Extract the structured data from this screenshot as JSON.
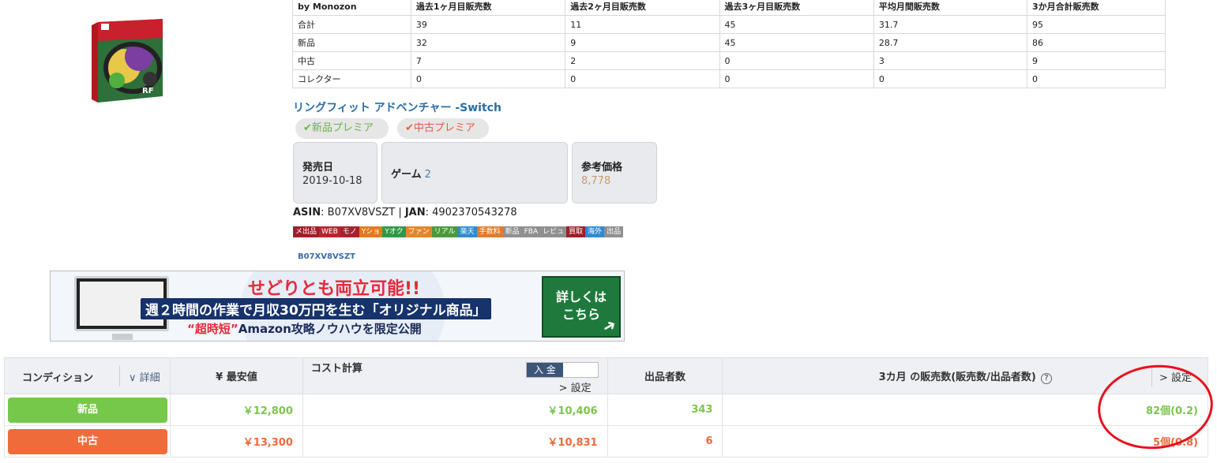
{
  "sales_table": {
    "headers": [
      "by Monozon",
      "過去1ヶ月目販売数",
      "過去2ヶ月目販売数",
      "過去3ヶ月目販売数",
      "平均月間販売数",
      "3か月合計販売数"
    ],
    "rows": [
      [
        "合計",
        "39",
        "11",
        "45",
        "31.7",
        "95"
      ],
      [
        "新品",
        "32",
        "9",
        "45",
        "28.7",
        "86"
      ],
      [
        "中古",
        "7",
        "2",
        "0",
        "3",
        "9"
      ],
      [
        "コレクター",
        "0",
        "0",
        "0",
        "0",
        "0"
      ]
    ]
  },
  "product": {
    "title": "リングフィット アドベンチャー -Switch",
    "badge_new": "✔新品プレミア",
    "badge_used": "✔中古プレミア",
    "release_label": "発売日",
    "release_value": "2019-10-18",
    "genre_label": "ゲーム",
    "genre_rank": "2",
    "price_label": "参考価格",
    "price_value": "8,778",
    "asin_label": "ASIN",
    "asin": "B07XV8VSZT",
    "jan_label": "JAN",
    "jan": "4902370543278",
    "asin_small": "B07XV8VSZT"
  },
  "tags": [
    {
      "label": "メ出品",
      "color": "#a01e2a"
    },
    {
      "label": "WEB",
      "color": "#b8262f"
    },
    {
      "label": "モノ",
      "color": "#a72231"
    },
    {
      "label": "Yショ",
      "color": "#e47a1f"
    },
    {
      "label": "Yオク",
      "color": "#2d9a46"
    },
    {
      "label": "ファン",
      "color": "#e6862a"
    },
    {
      "label": "リアル",
      "color": "#4a9a3c"
    },
    {
      "label": "楽天",
      "color": "#2f8bd1"
    },
    {
      "label": "手数料",
      "color": "#e57a2a"
    },
    {
      "label": "新品",
      "color": "#909090"
    },
    {
      "label": "FBA",
      "color": "#909090"
    },
    {
      "label": "レビュ",
      "color": "#909090"
    },
    {
      "label": "買取",
      "color": "#a01e2a"
    },
    {
      "label": "海外",
      "color": "#2f8bd1"
    },
    {
      "label": "出品",
      "color": "#909090"
    }
  ],
  "banner": {
    "headline": "せどりとも両立可能!!",
    "sub1": "週２時間の作業で月収30万円を生む「オリジナル商品」",
    "sub2_hl": "“超時短”",
    "sub2": "Amazon攻略ノウハウを限定公開",
    "cta_line1": "詳しくは",
    "cta_line2": "こちら"
  },
  "offers": {
    "headers": {
      "condition": "コンディション",
      "detail": "∨ 詳細",
      "lowest": "¥ 最安値",
      "cost": "コスト計算",
      "deposit": "入 金",
      "settings": "> 設定",
      "sellers": "出品者数",
      "sales": "3カ月 の販売数(販売数/出品者数)",
      "help": "?"
    },
    "rows": [
      {
        "condition": "新品",
        "lowest": "￥12,800",
        "cost": "￥10,406",
        "sellers": "343",
        "sales": "82個(0.2)"
      },
      {
        "condition": "中古",
        "lowest": "￥13,300",
        "cost": "￥10,831",
        "sellers": "6",
        "sales": "5個(0.8)"
      }
    ]
  }
}
